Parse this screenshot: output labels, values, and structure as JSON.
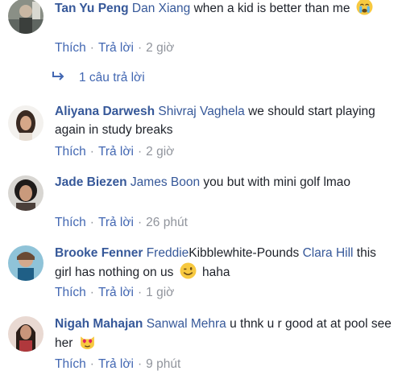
{
  "comments": [
    {
      "author": "Tan Yu Peng",
      "mention": "Dan Xiang",
      "text": " when a kid is better than me",
      "like": "Thích",
      "reply": "Trả lời",
      "time": "2 giờ",
      "emoji": "crying-face-emoji",
      "replies_label": "1 câu trả lời"
    },
    {
      "author": "Aliyana Darwesh",
      "mention": "Shivraj Vaghela",
      "text": " we should start playing again in study breaks",
      "like": "Thích",
      "reply": "Trả lời",
      "time": "2 giờ"
    },
    {
      "author": "Jade Biezen",
      "mention": "James Boon",
      "text": " you but with mini golf lmao",
      "like": "Thích",
      "reply": "Trả lời",
      "time": "26 phút"
    },
    {
      "author": "Brooke Fenner",
      "mention": "Freddie",
      "plain": "Kibblewhite-Pounds",
      "mention2": "Clara Hill",
      "text": " this girl has nothing on us",
      "text2": " haha",
      "like": "Thích",
      "reply": "Trả lời",
      "time": "1 giờ",
      "emoji": "winking-smile-emoji"
    },
    {
      "author": "Nigah Mahajan",
      "mention": "Sanwal Mehra",
      "text": " u thnk u r good at at pool see her",
      "like": "Thích",
      "reply": "Trả lời",
      "time": "9 phút",
      "emoji": "heart-eyes-cat-emoji"
    }
  ],
  "colors": {
    "link": "#365899",
    "action": "#4267b2",
    "meta": "#90949c",
    "text": "#1d2129"
  }
}
